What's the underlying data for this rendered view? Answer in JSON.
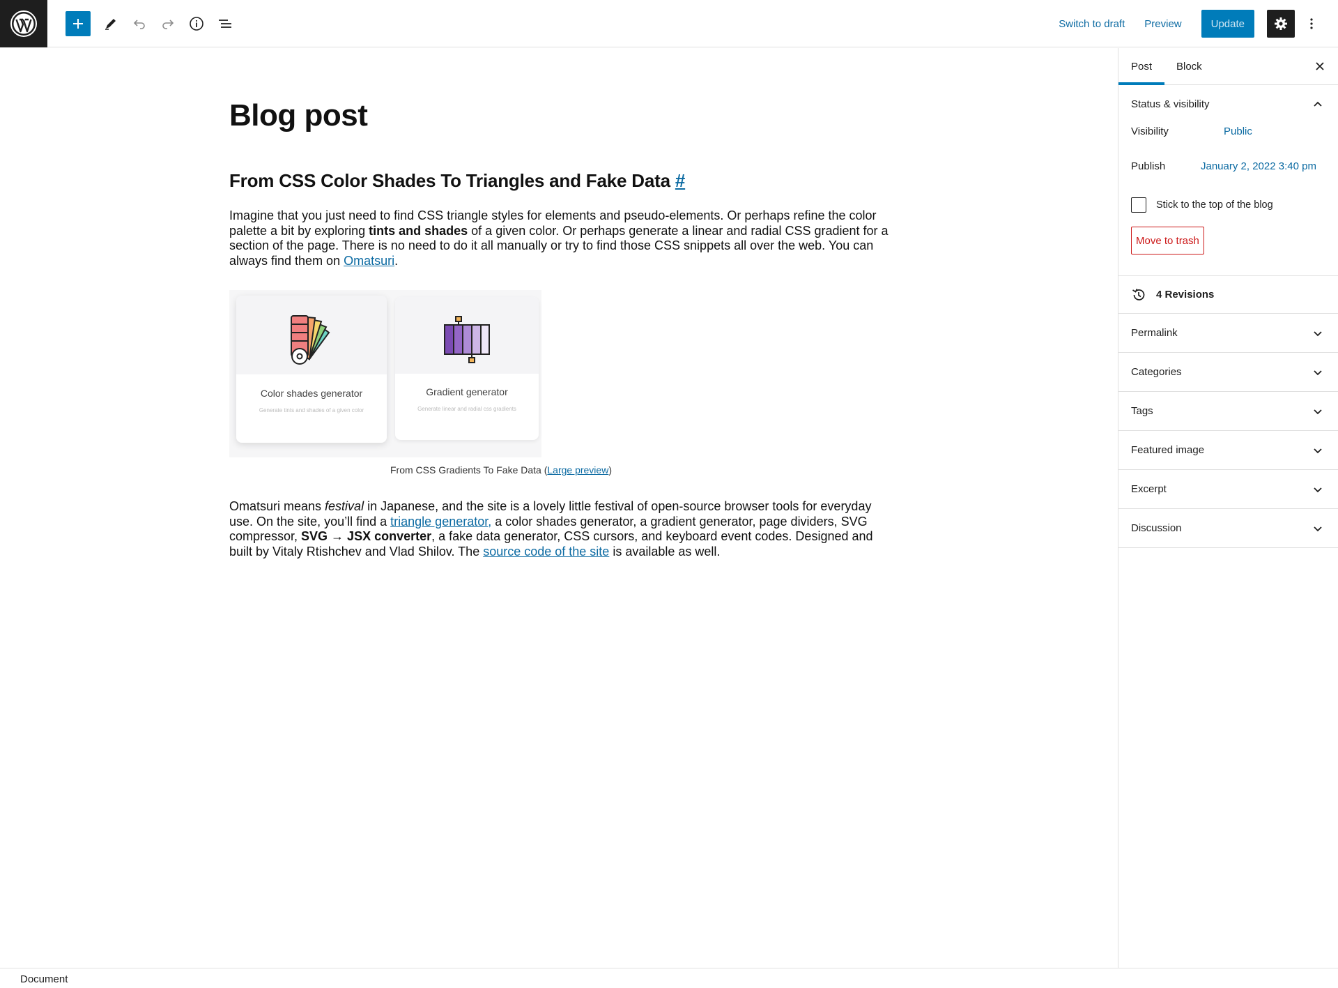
{
  "toolbar": {
    "logo_icon": "wordpress-logo",
    "add_icon": "plus-icon",
    "tools_icon": "pencil-icon",
    "undo_icon": "undo-icon",
    "redo_icon": "redo-icon",
    "details_icon": "info-icon",
    "outline_icon": "list-view-icon",
    "switch_to_draft": "Switch to draft",
    "preview": "Preview",
    "update": "Update",
    "settings_icon": "gear-icon",
    "more_icon": "more-vertical-icon"
  },
  "post": {
    "title": "Blog post",
    "heading": "From CSS Color Shades To Triangles and Fake Data",
    "heading_anchor": "#",
    "paragraph1": {
      "t1": "Imagine that you just need to find CSS triangle styles for elements and pseudo-elements. Or perhaps refine the color palette a bit by exploring ",
      "bold": "tints and shades",
      "t2": " of a given color. Or perhaps generate a linear and radial CSS gradient for a section of the page. There is no need to do it all manually or try to find those CSS snippets all over the web. You can always find them on ",
      "link": "Omatsuri",
      "t3": "."
    },
    "image": {
      "card1_title": "Color shades generator",
      "card1_subtitle": "Generate tints and shades of a given color",
      "card2_title": "Gradient generator",
      "card2_subtitle": "Generate linear and radial css gradients"
    },
    "caption": {
      "text": "From CSS Gradients To Fake Data (",
      "link": "Large preview",
      "end": ")"
    },
    "paragraph2": {
      "t1": "Omatsuri means ",
      "italic": "festival",
      "t2": " in Japanese, and the site is a lovely little festival of open-source browser tools for everyday use. On the site, you’ll find a ",
      "link1": "triangle generator,",
      "t3": " a color shades generator, a gradient generator, page dividers, SVG compressor, ",
      "bold": "SVG → JSX converter",
      "t4": ", a fake data generator, CSS cursors, and keyboard event codes. Designed and built by Vitaly Rtishchev and Vlad Shilov. The ",
      "link2": "source code of the site",
      "t5": " is available as well."
    }
  },
  "sidebar": {
    "tab_post": "Post",
    "tab_block": "Block",
    "close_icon": "close-icon",
    "status": {
      "title": "Status & visibility",
      "visibility_label": "Visibility",
      "visibility_value": "Public",
      "publish_label": "Publish",
      "publish_value": "January 2, 2022 3:40 pm",
      "sticky_label": "Stick to the top of the blog",
      "sticky_checked": false,
      "trash": "Move to trash"
    },
    "revisions": "4 Revisions",
    "panels": [
      "Permalink",
      "Categories",
      "Tags",
      "Featured image",
      "Excerpt",
      "Discussion"
    ]
  },
  "footer": {
    "breadcrumb": "Document"
  },
  "colors": {
    "accent": "#007cba",
    "link": "#0b6aa2",
    "danger": "#cc1818",
    "dark": "#1e1e1e"
  }
}
